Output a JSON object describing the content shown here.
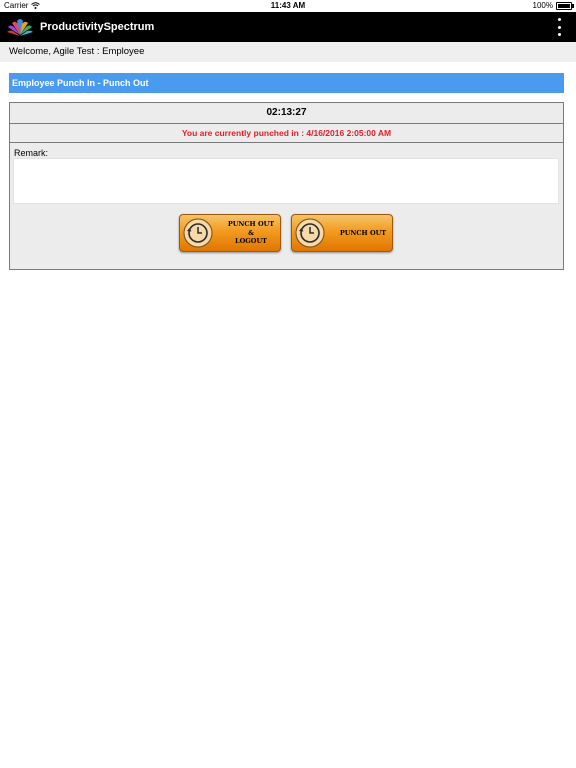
{
  "status_bar": {
    "carrier": "Carrier",
    "time": "11:43 AM",
    "battery": "100%"
  },
  "navbar": {
    "title": "ProductivitySpectrum"
  },
  "welcome": {
    "text": "Welcome, Agile Test : Employee"
  },
  "section": {
    "title": "Employee Punch In - Punch Out"
  },
  "panel": {
    "timer": "02:13:27",
    "status": "You are currently punched in : 4/16/2016 2:05:00 AM",
    "remark_label": "Remark:",
    "remark_value": ""
  },
  "buttons": {
    "punch_out_logout_line1": "PUNCH OUT",
    "punch_out_logout_line2": "&",
    "punch_out_logout_line3": "LOGOUT",
    "punch_out": "PUNCH OUT"
  },
  "colors": {
    "navbar_bg": "#000000",
    "section_header_bg": "#4a9bf0",
    "status_text": "#e0202a",
    "button_orange": "#f39a20"
  },
  "icons": [
    "wifi-icon",
    "battery-icon",
    "lotus-logo-icon",
    "more-vertical-icon",
    "clock-arrow-icon"
  ]
}
